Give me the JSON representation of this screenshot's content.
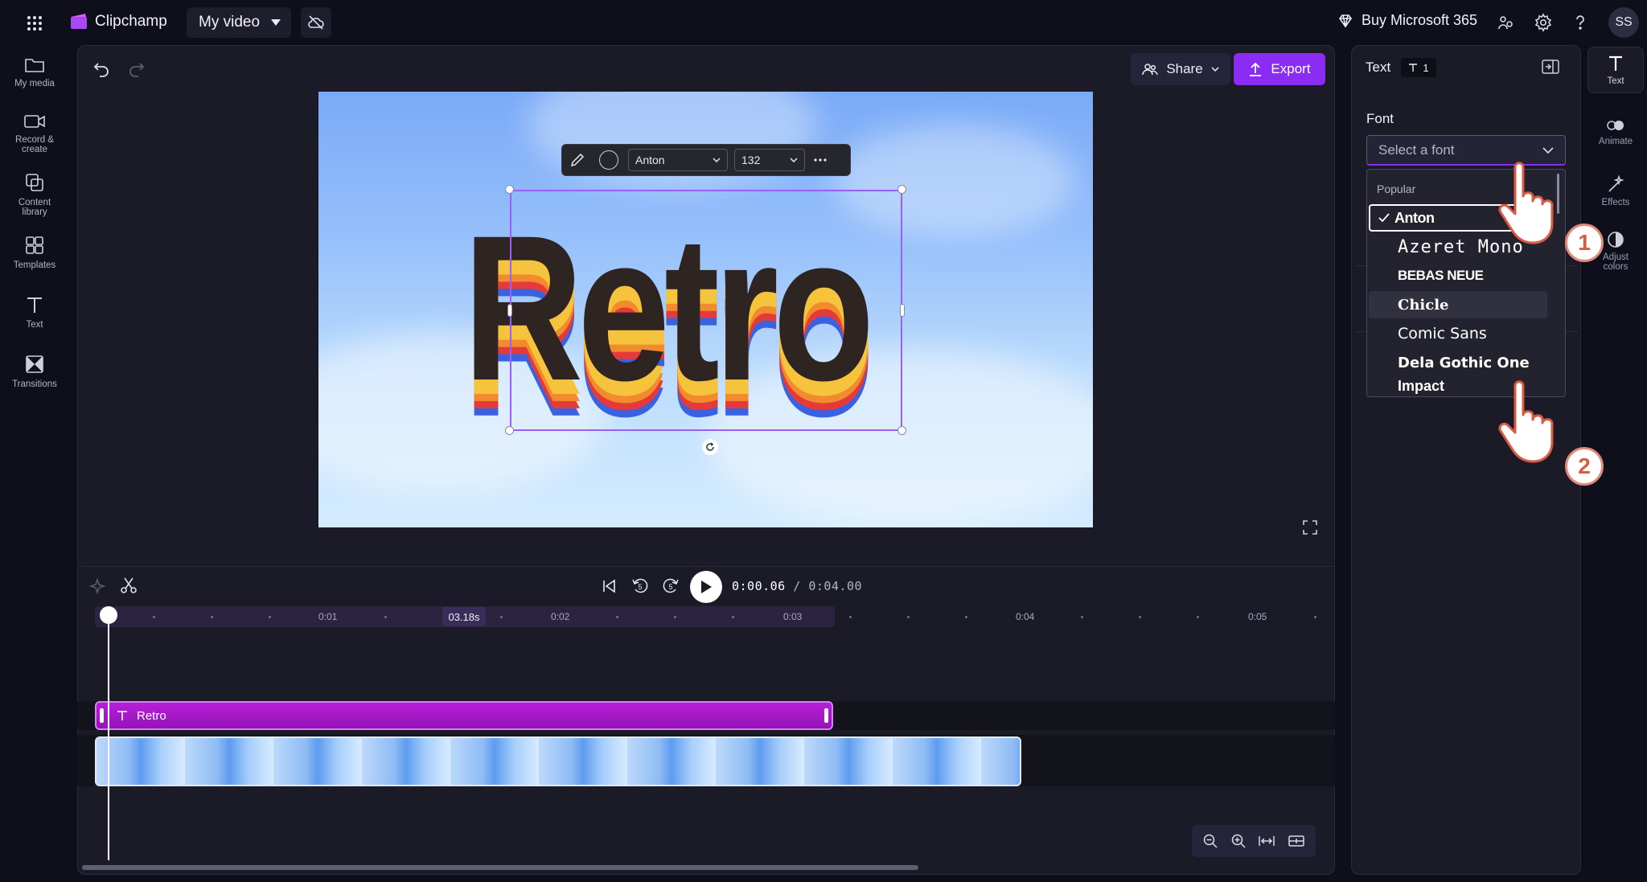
{
  "app": {
    "name": "Clipchamp",
    "project_name": "My video",
    "buy_label": "Buy Microsoft 365",
    "avatar_initials": "SS",
    "accent_color": "#8b2cf5"
  },
  "left_nav": [
    {
      "label": "My media",
      "icon": "folder-icon"
    },
    {
      "label": "Record & create",
      "icon": "camera-icon"
    },
    {
      "label": "Content library",
      "icon": "content-library-icon"
    },
    {
      "label": "Templates",
      "icon": "templates-icon"
    },
    {
      "label": "Text",
      "icon": "text-icon"
    },
    {
      "label": "Transitions",
      "icon": "transitions-icon"
    }
  ],
  "toolbar": {
    "share_label": "Share",
    "export_label": "Export"
  },
  "canvas": {
    "text": "Retro",
    "float_toolbar": {
      "font": "Anton",
      "size": "132"
    }
  },
  "playback": {
    "current_time": "0:00.06",
    "separator": " / ",
    "total_time": "0:04.00"
  },
  "timeline": {
    "ruler_labels": [
      "0:01",
      "0:02",
      "0:03",
      "0:04",
      "0:05"
    ],
    "time_badge": "03.18s",
    "text_clip_label": "Retro"
  },
  "right_panel": {
    "title": "Text",
    "badge_count": "1",
    "font_section_label": "Font",
    "font_select_placeholder": "Select a font",
    "dropdown_group": "Popular",
    "font_options": [
      {
        "label": "Anton",
        "selected": true
      },
      {
        "label": "Azeret Mono",
        "selected": false
      },
      {
        "label": "BEBAS NEUE",
        "selected": false
      },
      {
        "label": "Chicle",
        "selected": false,
        "hovered": true
      },
      {
        "label": "Comic Sans",
        "selected": false
      },
      {
        "label": "Dela Gothic One",
        "selected": false
      },
      {
        "label": "Impact",
        "selected": false
      }
    ]
  },
  "right_tabs": [
    {
      "label": "Text",
      "icon": "text-icon",
      "active": true
    },
    {
      "label": "Animate",
      "icon": "animate-icon"
    },
    {
      "label": "Effects",
      "icon": "effects-icon"
    },
    {
      "label": "Adjust colors",
      "icon": "adjust-colors-icon"
    }
  ],
  "annotations": {
    "step_1": "1",
    "step_2": "2"
  }
}
